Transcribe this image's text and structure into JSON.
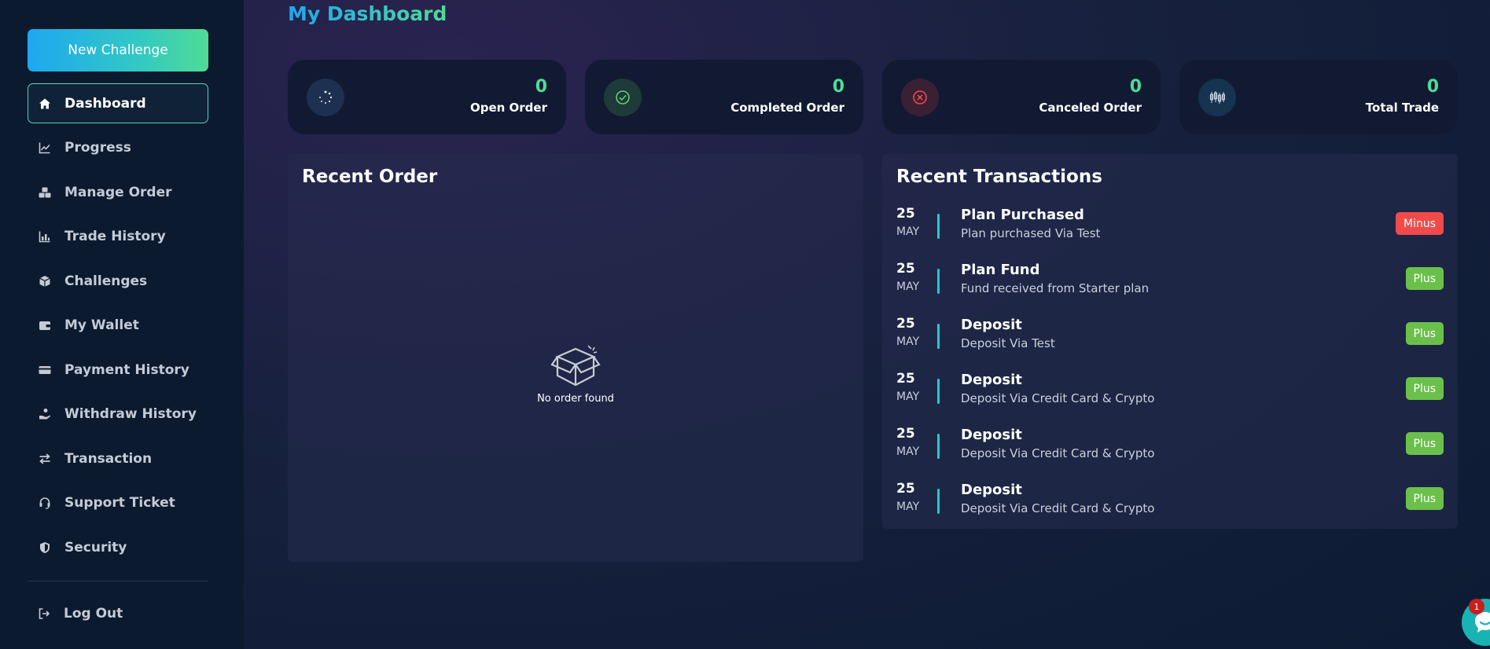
{
  "sidebar": {
    "new_challenge_label": "New Challenge",
    "items": [
      {
        "label": "Dashboard",
        "icon": "home-icon",
        "active": true
      },
      {
        "label": "Progress",
        "icon": "line-chart-icon"
      },
      {
        "label": "Manage Order",
        "icon": "boxes-icon"
      },
      {
        "label": "Trade History",
        "icon": "bar-chart-icon"
      },
      {
        "label": "Challenges",
        "icon": "cube-icon"
      },
      {
        "label": "My Wallet",
        "icon": "wallet-icon"
      },
      {
        "label": "Payment History",
        "icon": "credit-card-icon"
      },
      {
        "label": "Withdraw History",
        "icon": "hand-coin-icon"
      },
      {
        "label": "Transaction",
        "icon": "swap-arrows-icon"
      },
      {
        "label": "Support Ticket",
        "icon": "headset-icon"
      },
      {
        "label": "Security",
        "icon": "shield-icon"
      }
    ],
    "logout_label": "Log Out"
  },
  "main": {
    "title": "My Dashboard",
    "stats": [
      {
        "value": "0",
        "label": "Open Order",
        "icon": "spinner-icon",
        "color": "#4fdb96"
      },
      {
        "value": "0",
        "label": "Completed Order",
        "icon": "check-circle-icon",
        "color": "#4fdb96"
      },
      {
        "value": "0",
        "label": "Canceled Order",
        "icon": "x-circle-icon",
        "color": "#f04a4a"
      },
      {
        "value": "0",
        "label": "Total Trade",
        "icon": "candlestick-icon",
        "color": "#4fdb96"
      }
    ],
    "recent_order": {
      "title": "Recent Order",
      "empty_text": "No order found"
    },
    "recent_transactions": {
      "title": "Recent Transactions",
      "rows": [
        {
          "day": "25",
          "month": "MAY",
          "title": "Plan Purchased",
          "desc": "Plan purchased Via Test",
          "badge": "Minus"
        },
        {
          "day": "25",
          "month": "MAY",
          "title": "Plan Fund",
          "desc": "Fund received from Starter plan",
          "badge": "Plus"
        },
        {
          "day": "25",
          "month": "MAY",
          "title": "Deposit",
          "desc": "Deposit Via Test",
          "badge": "Plus"
        },
        {
          "day": "25",
          "month": "MAY",
          "title": "Deposit",
          "desc": "Deposit Via Credit Card & Crypto",
          "badge": "Plus"
        },
        {
          "day": "25",
          "month": "MAY",
          "title": "Deposit",
          "desc": "Deposit Via Credit Card & Crypto",
          "badge": "Plus"
        },
        {
          "day": "25",
          "month": "MAY",
          "title": "Deposit",
          "desc": "Deposit Via Credit Card & Crypto",
          "badge": "Plus"
        }
      ]
    }
  },
  "chat": {
    "unread_count": "1"
  },
  "colors": {
    "accent_blue": "#1ea7f0",
    "accent_green": "#4fdb96",
    "minus_red": "#f04a4a",
    "plus_green": "#6bc04b"
  }
}
